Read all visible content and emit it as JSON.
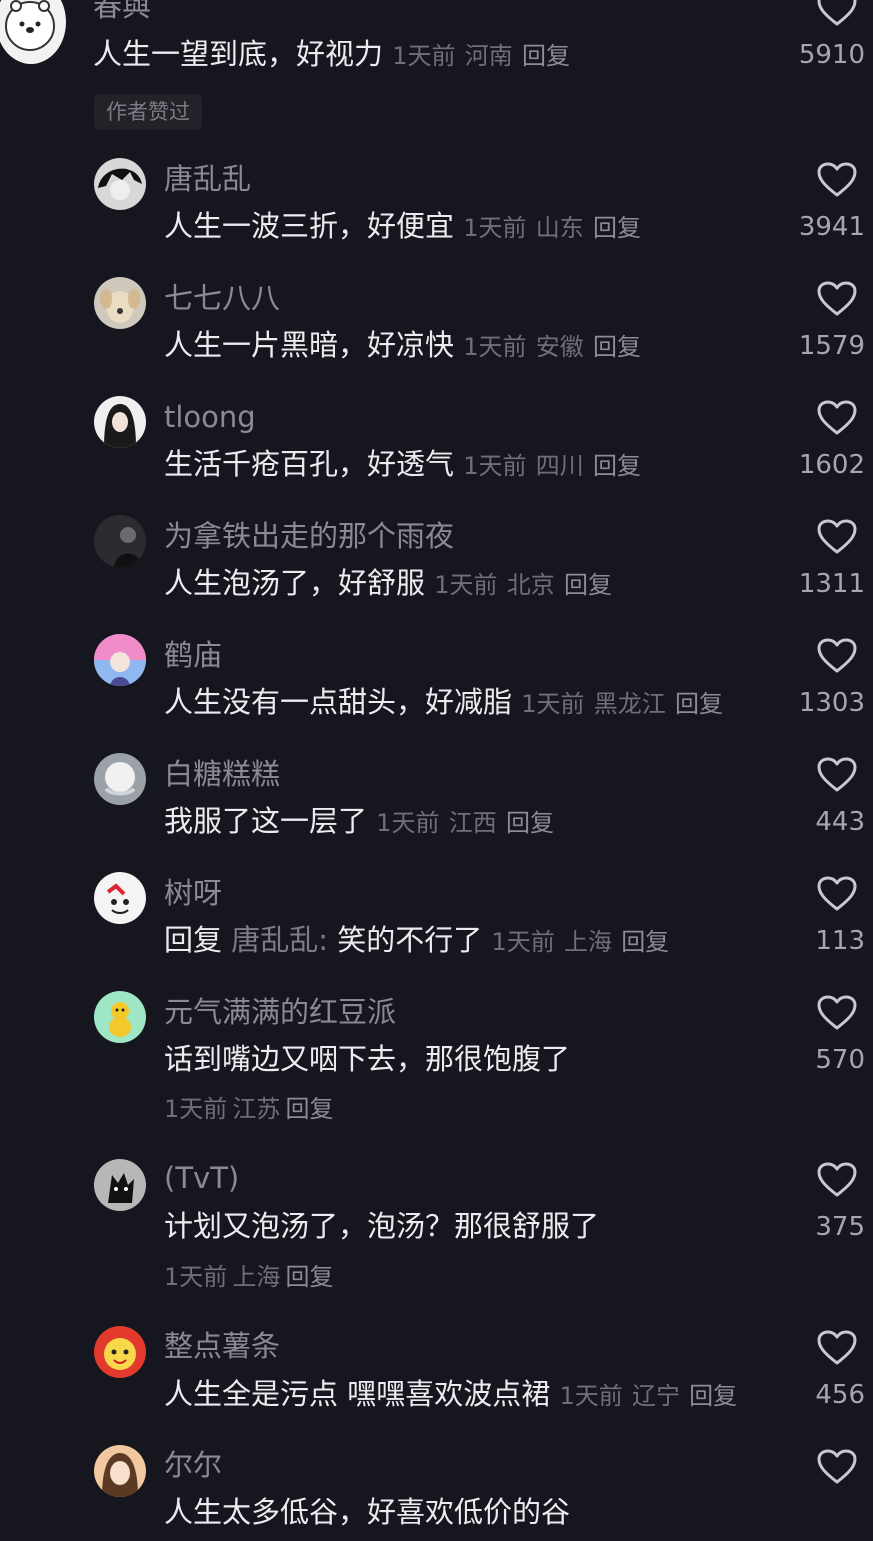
{
  "author_liked_tag": "作者赞过",
  "comments": [
    {
      "username": "春與",
      "text": "人生一望到底，好视力",
      "time": "1天前",
      "location": "河南",
      "reply": "回复",
      "likes": "5910"
    },
    {
      "username": "唐乱乱",
      "text": "人生一波三折，好便宜",
      "time": "1天前",
      "location": "山东",
      "reply": "回复",
      "likes": "3941"
    },
    {
      "username": "七七八八",
      "text": "人生一片黑暗，好凉快",
      "time": "1天前",
      "location": "安徽",
      "reply": "回复",
      "likes": "1579"
    },
    {
      "username": "tloong",
      "text": "生活千疮百孔，好透气",
      "time": "1天前",
      "location": "四川",
      "reply": "回复",
      "likes": "1602"
    },
    {
      "username": "为拿铁出走的那个雨夜",
      "text": "人生泡汤了，好舒服",
      "time": "1天前",
      "location": "北京",
      "reply": "回复",
      "likes": "1311"
    },
    {
      "username": "鹤庙",
      "text": "人生没有一点甜头，好减脂",
      "time": "1天前",
      "location": "黑龙江",
      "reply": "回复",
      "likes": "1303"
    },
    {
      "username": "白糖糕糕",
      "text": "我服了这一层了",
      "time": "1天前",
      "location": "江西",
      "reply": "回复",
      "likes": "443"
    },
    {
      "username": "树呀",
      "reply_prefix": "回复",
      "reply_target": "唐乱乱:",
      "text": "笑的不行了",
      "time": "1天前",
      "location": "上海",
      "reply": "回复",
      "likes": "113"
    },
    {
      "username": "元气满满的红豆派",
      "text": "话到嘴边又咽下去，那很饱腹了",
      "time": "1天前",
      "location": "江苏",
      "reply": "回复",
      "likes": "570"
    },
    {
      "username": "(TvT)",
      "text": "计划又泡汤了，泡汤？那很舒服了",
      "time": "1天前",
      "location": "上海",
      "reply": "回复",
      "likes": "375"
    },
    {
      "username": "整点薯条",
      "text": "人生全是污点 嘿嘿喜欢波点裙",
      "time": "1天前",
      "location": "辽宁",
      "reply": "回复",
      "likes": "456"
    },
    {
      "username": "尔尔",
      "text": "人生太多低谷，好喜欢低价的谷"
    }
  ]
}
